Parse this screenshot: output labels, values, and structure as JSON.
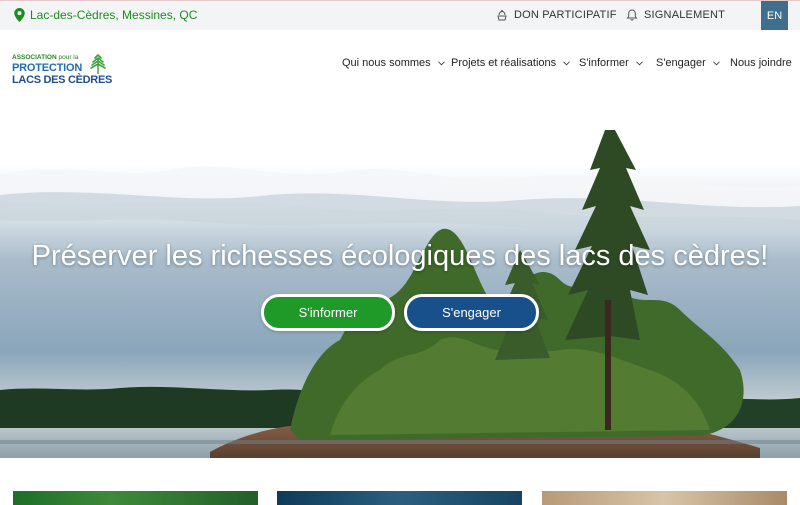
{
  "topbar": {
    "location": "Lac-des-Cèdres, Messines, QC",
    "don_label": "DON PARTICIPATIF",
    "signalement_label": "SIGNALEMENT",
    "lang_label": "EN",
    "icons": [
      "map-pin-icon",
      "donation-hand-icon",
      "bell-icon"
    ]
  },
  "header": {
    "logo": {
      "line1a": "ASSOCIATION",
      "line1b": " pour la",
      "line2": "PROTECTION",
      "line3": "LACS DES CÈDRES"
    },
    "nav": [
      {
        "label": "Qui nous sommes",
        "has_dropdown": true
      },
      {
        "label": "Projets et réalisations",
        "has_dropdown": true
      },
      {
        "label": "S'informer",
        "has_dropdown": true
      },
      {
        "label": "S'engager",
        "has_dropdown": true
      },
      {
        "label": "Nous joindre",
        "has_dropdown": false
      }
    ]
  },
  "hero": {
    "title": "Préserver les richesses écologiques des lacs des cèdres!",
    "button_primary": "S'informer",
    "button_secondary": "S'engager"
  },
  "colors": {
    "brand_green": "#1f9a28",
    "brand_blue": "#17508a",
    "lang_bg": "#3f6f8c"
  }
}
